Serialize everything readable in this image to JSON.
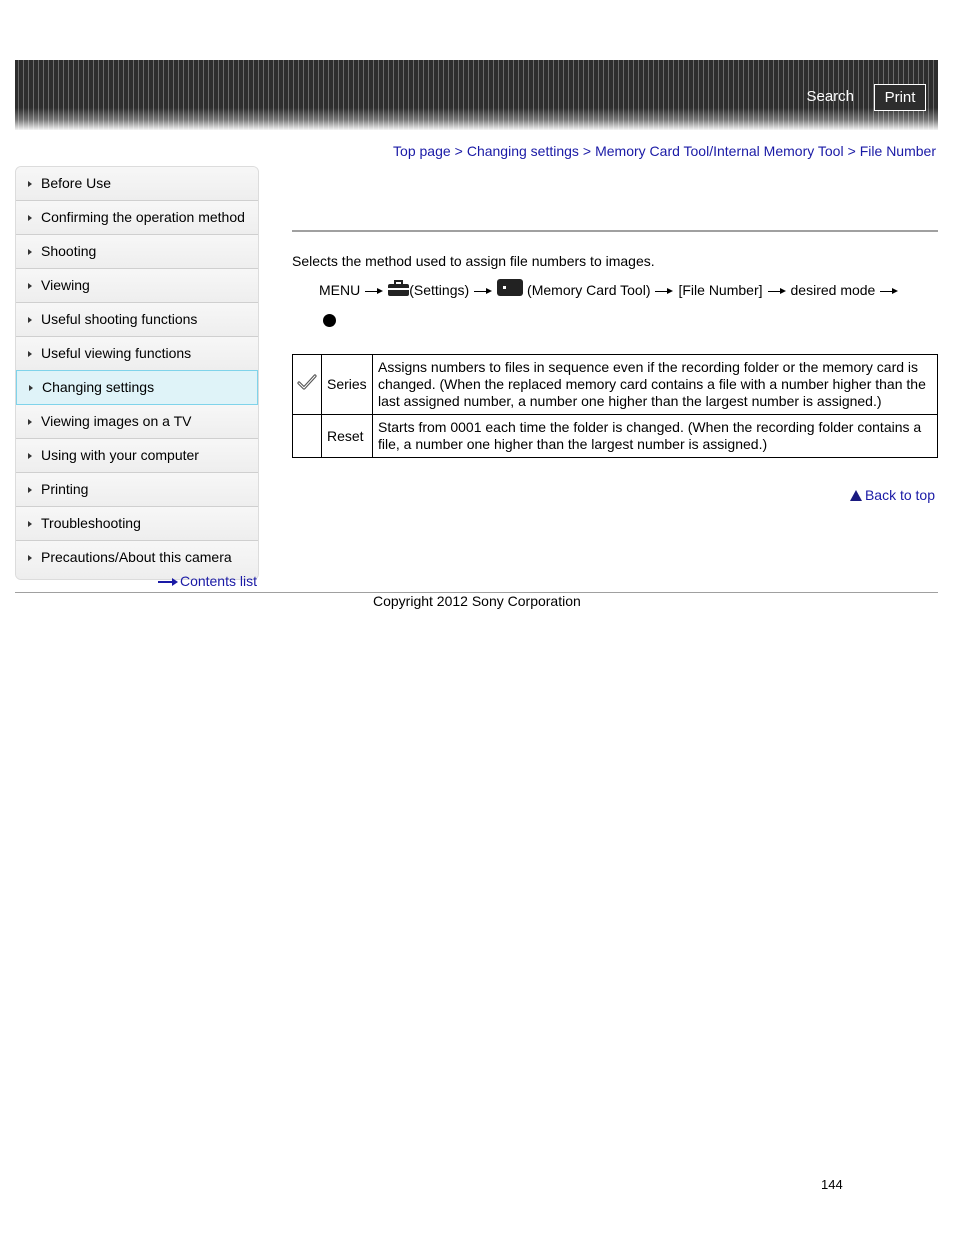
{
  "header": {
    "search_label": "Search",
    "print_label": "Print"
  },
  "breadcrumb": {
    "items": [
      "Top page",
      "Changing settings",
      "Memory Card Tool/Internal Memory Tool",
      "File Number"
    ],
    "separator": ">"
  },
  "sidebar": {
    "items": [
      {
        "label": "Before Use"
      },
      {
        "label": "Confirming the operation method"
      },
      {
        "label": "Shooting"
      },
      {
        "label": "Viewing"
      },
      {
        "label": "Useful shooting functions"
      },
      {
        "label": "Useful viewing functions"
      },
      {
        "label": "Changing settings",
        "active": true
      },
      {
        "label": "Viewing images on a TV"
      },
      {
        "label": "Using with your computer"
      },
      {
        "label": "Printing"
      },
      {
        "label": "Troubleshooting"
      },
      {
        "label": "Precautions/About this camera"
      }
    ],
    "contents_list_label": "Contents list"
  },
  "main": {
    "description": "Selects the method used to assign file numbers to images.",
    "steps": {
      "menu": "MENU",
      "settings": "(Settings)",
      "memory_card_tool": "(Memory Card Tool)",
      "file_number": "[File Number]",
      "desired_mode": "desired mode"
    },
    "table": {
      "rows": [
        {
          "icon": "checkmark-icon",
          "default": true,
          "name": "Series",
          "description": "Assigns numbers to files in sequence even if the recording folder or the memory card is changed. (When the replaced memory card contains a file with a number higher than the last assigned number, a number one higher than the largest number is assigned.)"
        },
        {
          "icon": "",
          "default": false,
          "name": "Reset",
          "description": "Starts from 0001 each time the folder is changed. (When the recording folder contains a file, a number one higher than the largest number is assigned.)"
        }
      ]
    },
    "back_to_top_label": "Back to top"
  },
  "footer": {
    "copyright": "Copyright 2012 Sony Corporation",
    "page_number": "144"
  },
  "colors": {
    "link": "#1a1aa6",
    "active_nav_bg": "#dff3f8",
    "active_nav_border": "#7fd3ea"
  }
}
